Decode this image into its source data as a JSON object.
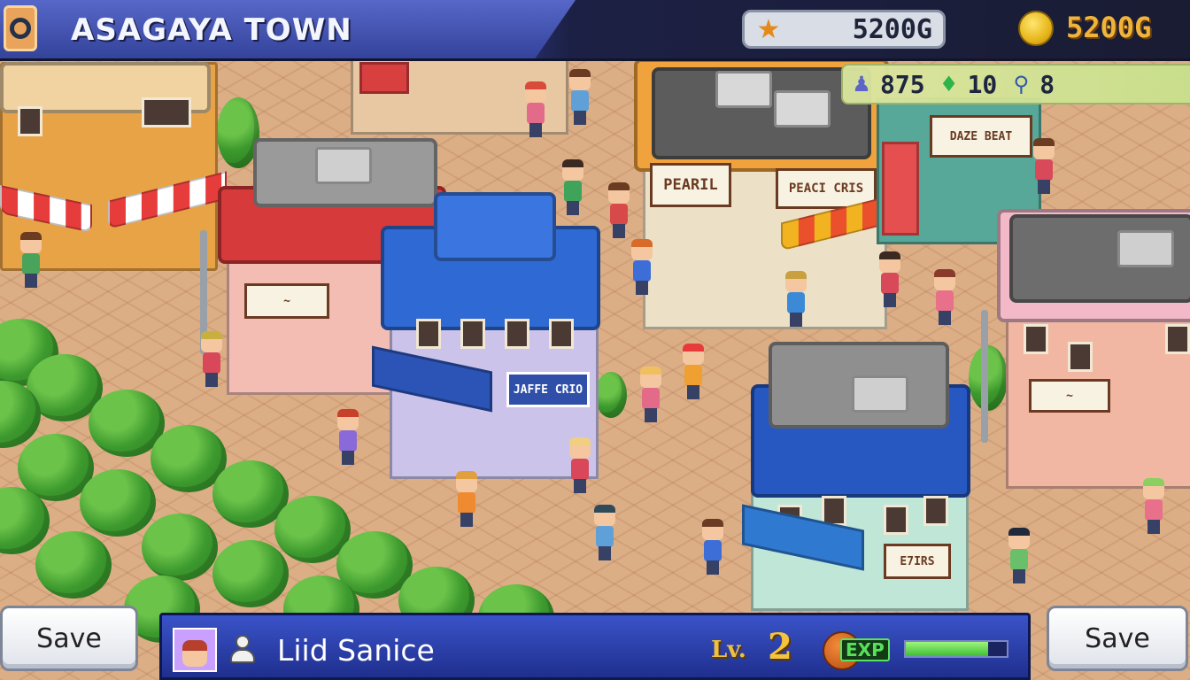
{
  "header": {
    "town_name": "ASAGAYA TOWN",
    "funds_value": "5200G",
    "gold_value": "5200G"
  },
  "stats": {
    "population": "875",
    "gems": "10",
    "map_points": "8"
  },
  "signs": {
    "cafe": "PEARIL",
    "cafe_banner": "PEACI CRIS",
    "fashion_shop": "JAFFE CRIO",
    "bakery": "E7IRS",
    "shop_top_right": "DAZE BEAT"
  },
  "player": {
    "name": "Liid Sanice",
    "level_label": "Lv.",
    "level": "2",
    "exp_label": "EXP",
    "exp_fraction": 0.82
  },
  "buttons": {
    "save_left": "Save",
    "save_right": "Save"
  },
  "icons": {
    "menu": "menu-ring-icon",
    "funds": "star-icon",
    "gold": "coin-icon",
    "population": "population-icon",
    "gems": "gem-icon",
    "map_points": "map-pin-icon",
    "user": "user-icon",
    "exp": "exp-orb-icon"
  }
}
